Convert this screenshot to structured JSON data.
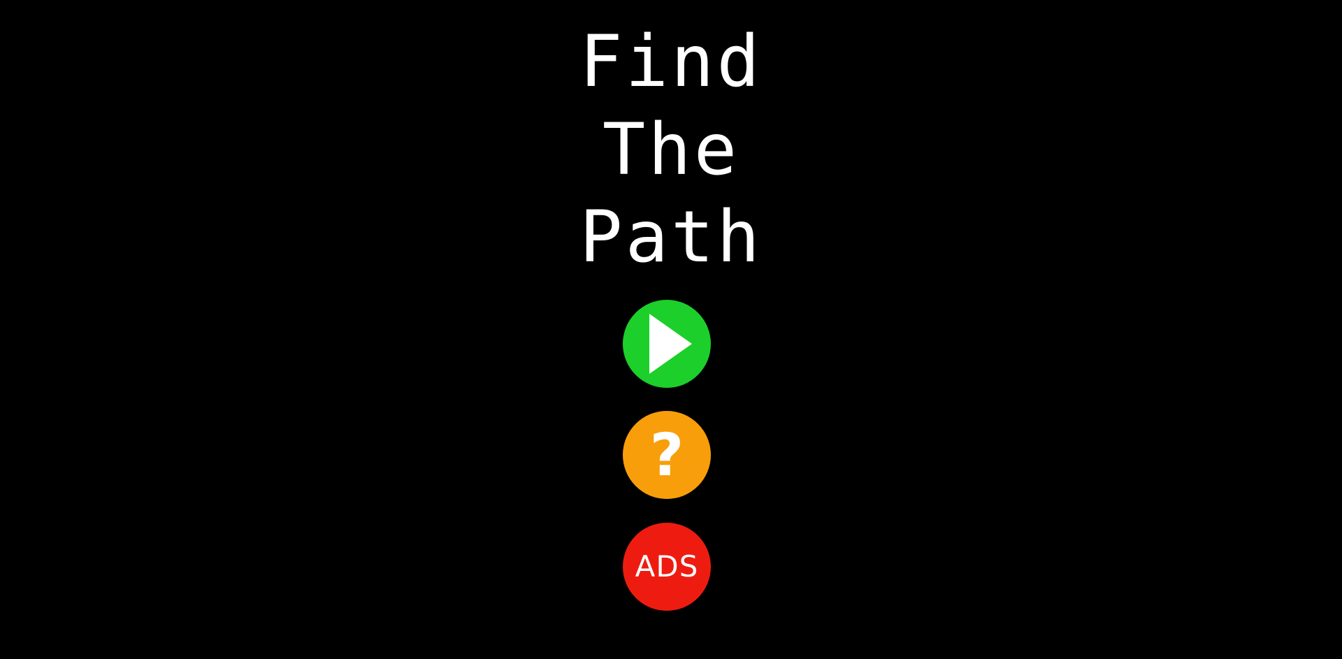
{
  "title": {
    "line1": "Find",
    "line2": "The",
    "line3": "Path"
  },
  "menu": {
    "play": {
      "icon": "play-icon",
      "color": "#1ccf2a"
    },
    "help": {
      "icon": "question-mark-icon",
      "label": "?",
      "color": "#f89e0a"
    },
    "ads": {
      "label": "ADS",
      "color": "#ee1c10"
    }
  }
}
